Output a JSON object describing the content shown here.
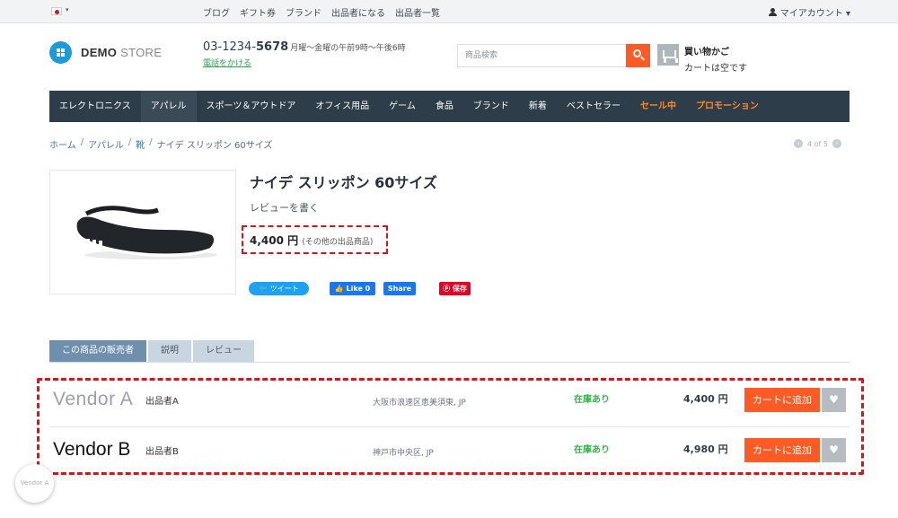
{
  "topbar": {
    "links": [
      "ブログ",
      "ギフト券",
      "ブランド",
      "出品者になる",
      "出品者一覧"
    ],
    "account_label": "マイアカウント ▾"
  },
  "header": {
    "logo_demo": "DEMO",
    "logo_store": "STORE",
    "phone_prefix": "03-1234-",
    "phone_bold": "5678",
    "phone_hours": "月曜〜金曜の午前9時〜午後6時",
    "callback_label": "電話をかける",
    "search_placeholder": "商品検索",
    "cart_title": "買い物かご",
    "cart_status": "カートは空です"
  },
  "nav": {
    "items": [
      "エレクトロニクス",
      "アパレル",
      "スポーツ＆アウトドア",
      "オフィス用品",
      "ゲーム",
      "食品",
      "ブランド",
      "新着",
      "ベストセラー",
      "セール中",
      "プロモーション"
    ],
    "active_index": 1
  },
  "breadcrumb": {
    "home": "ホーム",
    "sep": "/",
    "level1": "アパレル",
    "level2": "靴",
    "current": "ナイデ スリッポン 60サイズ"
  },
  "pager": {
    "label": "4 of 5"
  },
  "product": {
    "title": "ナイデ スリッポン 60サイズ",
    "review_link": "レビューを書く",
    "price": "4,400 円",
    "price_note": "(その他の出品商品)"
  },
  "social": {
    "tweet": "ツイート",
    "fb_like": "Like 0",
    "fb_share": "Share",
    "pin": "保存"
  },
  "tabs": [
    "この商品の販売者",
    "説明",
    "レビュー"
  ],
  "vendors": [
    {
      "logo": "Vendor A",
      "name": "出品者A",
      "location": "大阪市浪速区恵美須東, JP",
      "stock": "在庫あり",
      "price": "4,400 円",
      "add_label": "カートに追加"
    },
    {
      "logo": "Vendor B",
      "name": "出品者B",
      "location": "神戸市中央区, JP",
      "stock": "在庫あり",
      "price": "4,980 円",
      "add_label": "カートに追加"
    }
  ],
  "chat_label": "Vendor A",
  "colors": {
    "accent": "#fe5a23",
    "nav_bg": "#2e3d4a",
    "stock": "#34b34a",
    "highlight": "#e0101a"
  }
}
